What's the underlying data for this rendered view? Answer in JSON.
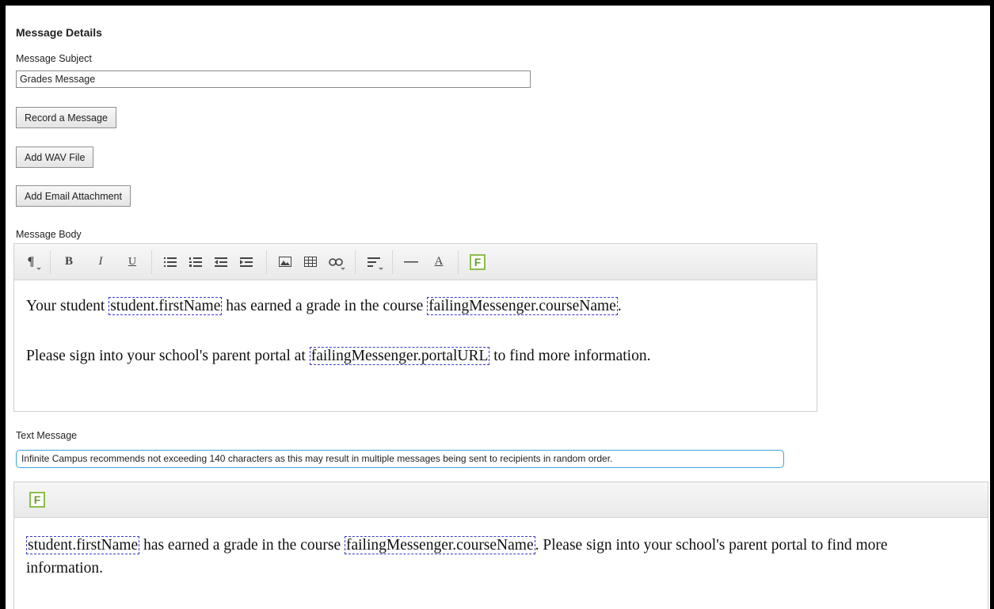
{
  "section_title": "Message Details",
  "subject": {
    "label": "Message Subject",
    "value": "Grades Message"
  },
  "buttons": {
    "record": "Record a Message",
    "add_wav": "Add WAV File",
    "add_email_attachment": "Add Email Attachment"
  },
  "message_body": {
    "label": "Message Body",
    "toolbar_icons": [
      "paragraph-icon",
      "bold-icon",
      "italic-icon",
      "underline-icon",
      "unordered-list-icon",
      "ordered-list-icon",
      "outdent-icon",
      "indent-icon",
      "image-icon",
      "table-icon",
      "link-icon",
      "align-icon",
      "horizontal-rule-icon",
      "font-color-icon",
      "field-insert-icon"
    ],
    "toolbar_glyphs": {
      "paragraph": "¶",
      "bold": "B",
      "italic": "I",
      "underline": "U",
      "font_color": "A",
      "field": "F"
    },
    "line1": {
      "pre": "Your student ",
      "field1": "student.firstName",
      "mid": " has earned a grade in the course ",
      "field2": "failingMessenger.courseName",
      "post": "."
    },
    "line2": {
      "pre": "Please sign into your school's parent portal at ",
      "field": "failingMessenger.portalURL",
      "post": " to find more information."
    }
  },
  "text_message": {
    "label": "Text Message",
    "notice": "Infinite Campus recommends not exceeding 140 characters as this may result in multiple messages being sent to recipients in random order.",
    "field_button": "F",
    "content": {
      "field1": "student.firstName",
      "mid": " has earned a grade in the course ",
      "field2": "failingMessenger.courseName",
      "post": ". Please sign into your school's parent portal to find more information."
    }
  },
  "colors": {
    "field_border": "#3b3bd0",
    "notice_border": "#3aa6dd",
    "field_button_border": "#8bbd4b"
  }
}
